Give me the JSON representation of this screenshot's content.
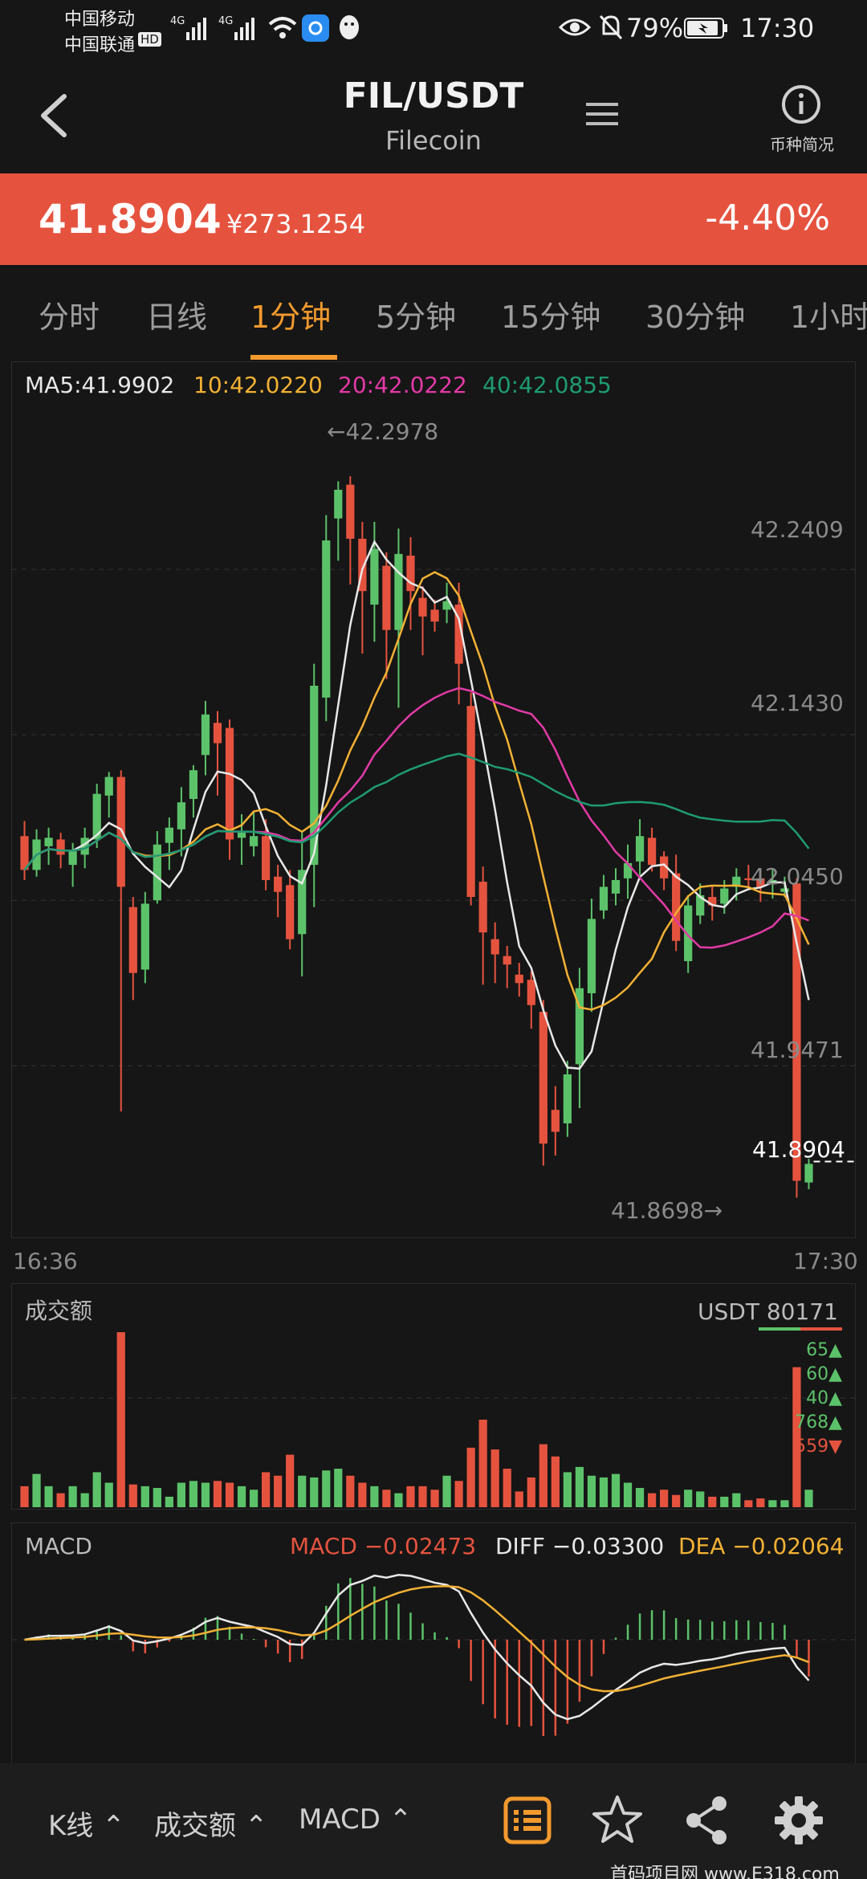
{
  "status": {
    "carrier1": "中国移动",
    "carrier2": "中国联通",
    "hd": "HD",
    "net1": "4G",
    "net2": "4G",
    "battery": "79%",
    "time": "17:30"
  },
  "header": {
    "title": "FIL/USDT",
    "subtitle": "Filecoin",
    "info_label": "币种简况"
  },
  "price": {
    "last": "41.8904",
    "cny": "¥273.1254",
    "change": "-4.40%",
    "bar_color": "#e5533f"
  },
  "tabs": [
    {
      "label": "分时",
      "active": false
    },
    {
      "label": "日线",
      "active": false
    },
    {
      "label": "1分钟",
      "active": true
    },
    {
      "label": "5分钟",
      "active": false
    },
    {
      "label": "15分钟",
      "active": false
    },
    {
      "label": "30分钟",
      "active": false
    },
    {
      "label": "1小时",
      "active": false
    }
  ],
  "kline": {
    "ma_legend": {
      "ma5": "MA5:41.9902",
      "ma10": "10:42.0220",
      "ma20": "20:42.0222",
      "ma40": "40:42.0855"
    },
    "colors": {
      "up": "#5cc26a",
      "down": "#e5533f",
      "ma5": "#e8e8e8",
      "ma10": "#f2b134",
      "ma20": "#e23aa6",
      "ma40": "#1e9b72"
    },
    "y_ticks": [
      "42.2409",
      "42.1430",
      "42.0450",
      "41.9471"
    ],
    "high_label": "←42.2978",
    "low_label": "41.8698→",
    "last_price_label": "41.8904",
    "x_start": "16:36",
    "x_end": "17:30"
  },
  "chart_data": {
    "type": "candlestick",
    "title": "",
    "x_range": [
      "16:36",
      "17:30"
    ],
    "ylim": [
      41.855,
      42.335
    ],
    "gridlines": [
      42.2409,
      42.143,
      42.045,
      41.9471
    ],
    "candles": [
      [
        42.083,
        42.063,
        42.092,
        42.057
      ],
      [
        42.063,
        42.081,
        42.087,
        42.059
      ],
      [
        42.077,
        42.082,
        42.088,
        42.066
      ],
      [
        42.081,
        42.072,
        42.085,
        42.064
      ],
      [
        42.066,
        42.074,
        42.079,
        42.053
      ],
      [
        42.072,
        42.082,
        42.088,
        42.064
      ],
      [
        42.081,
        42.108,
        42.114,
        42.076
      ],
      [
        42.107,
        42.118,
        42.121,
        42.094
      ],
      [
        42.118,
        42.053,
        42.122,
        41.92
      ],
      [
        42.041,
        42.002,
        42.047,
        41.986
      ],
      [
        42.004,
        42.043,
        42.05,
        41.996
      ],
      [
        42.045,
        42.078,
        42.086,
        42.043
      ],
      [
        42.079,
        42.088,
        42.094,
        42.063
      ],
      [
        42.087,
        42.103,
        42.112,
        42.071
      ],
      [
        42.105,
        42.122,
        42.125,
        42.094
      ],
      [
        42.131,
        42.155,
        42.163,
        42.119
      ],
      [
        42.15,
        42.138,
        42.157,
        42.107
      ],
      [
        42.147,
        42.081,
        42.152,
        42.069
      ],
      [
        42.082,
        42.085,
        42.096,
        42.066
      ],
      [
        42.077,
        42.083,
        42.097,
        42.071
      ],
      [
        42.083,
        42.057,
        42.093,
        42.051
      ],
      [
        42.059,
        42.05,
        42.066,
        42.035
      ],
      [
        42.054,
        42.022,
        42.063,
        42.016
      ],
      [
        42.025,
        42.063,
        42.085,
        42.0
      ],
      [
        42.066,
        42.172,
        42.185,
        42.041
      ],
      [
        42.165,
        42.258,
        42.273,
        42.151
      ],
      [
        42.271,
        42.288,
        42.293,
        42.246
      ],
      [
        42.291,
        42.259,
        42.296,
        42.232
      ],
      [
        42.259,
        42.228,
        42.269,
        42.191
      ],
      [
        42.22,
        42.253,
        42.269,
        42.198
      ],
      [
        42.243,
        42.205,
        42.251,
        42.176
      ],
      [
        42.205,
        42.25,
        42.265,
        42.159
      ],
      [
        42.249,
        42.228,
        42.26,
        42.205
      ],
      [
        42.224,
        42.213,
        42.231,
        42.19
      ],
      [
        42.217,
        42.21,
        42.223,
        42.204
      ],
      [
        42.217,
        42.222,
        42.233,
        42.209
      ],
      [
        42.22,
        42.185,
        42.233,
        42.161
      ],
      [
        42.16,
        42.047,
        42.168,
        42.042
      ],
      [
        42.056,
        42.026,
        42.065,
        41.995
      ],
      [
        42.022,
        42.013,
        42.032,
        41.996
      ],
      [
        42.012,
        42.007,
        42.018,
        41.993
      ],
      [
        42.001,
        41.996,
        42.008,
        41.988
      ],
      [
        41.998,
        41.983,
        42.003,
        41.969
      ],
      [
        41.979,
        41.901,
        41.986,
        41.888
      ],
      [
        41.921,
        41.908,
        41.935,
        41.894
      ],
      [
        41.913,
        41.942,
        41.95,
        41.905
      ],
      [
        41.948,
        41.993,
        42.005,
        41.922
      ],
      [
        41.99,
        42.034,
        42.046,
        41.979
      ],
      [
        42.039,
        42.053,
        42.06,
        42.034
      ],
      [
        42.049,
        42.057,
        42.064,
        42.042
      ],
      [
        42.058,
        42.067,
        42.078,
        42.046
      ],
      [
        42.068,
        42.083,
        42.093,
        42.06
      ],
      [
        42.082,
        42.066,
        42.088,
        42.062
      ],
      [
        42.071,
        42.058,
        42.074,
        42.051
      ],
      [
        42.061,
        42.021,
        42.072,
        42.015
      ],
      [
        42.009,
        42.042,
        42.048,
        42.002
      ],
      [
        42.036,
        42.048,
        42.055,
        42.031
      ],
      [
        42.047,
        42.042,
        42.054,
        42.033
      ],
      [
        42.043,
        42.052,
        42.057,
        42.037
      ],
      [
        42.053,
        42.059,
        42.064,
        42.045
      ],
      [
        42.058,
        42.057,
        42.066,
        42.051
      ],
      [
        42.058,
        42.053,
        42.064,
        42.044
      ],
      [
        42.055,
        42.057,
        42.063,
        42.046
      ],
      [
        42.05,
        42.052,
        42.059,
        42.047
      ],
      [
        42.055,
        41.879,
        42.058,
        41.869
      ],
      [
        41.878,
        41.889,
        41.892,
        41.874
      ]
    ],
    "high": 42.2978,
    "low": 41.8698,
    "last": 41.8904
  },
  "volume": {
    "label": "成交额",
    "unit_label": "USDT 80171",
    "levels": [
      {
        "value": "65▲",
        "dir": "up"
      },
      {
        "value": "60▲",
        "dir": "up"
      },
      {
        "value": "40▲",
        "dir": "up"
      },
      {
        "value": "768▲",
        "dir": "up"
      },
      {
        "value": "559▼",
        "dir": "down"
      }
    ],
    "values": [
      12,
      19,
      12,
      8,
      12,
      8,
      20,
      14,
      100,
      13,
      12,
      11,
      6,
      14,
      15,
      14,
      15,
      14,
      12,
      10,
      20,
      18,
      30,
      18,
      17,
      21,
      22,
      18,
      14,
      12,
      10,
      8,
      12,
      12,
      10,
      18,
      15,
      34,
      50,
      33,
      22,
      9,
      17,
      36,
      29,
      20,
      23,
      18,
      17,
      19,
      14,
      11,
      8,
      10,
      7,
      10,
      9,
      6,
      6,
      8,
      4,
      5,
      4,
      4,
      80,
      10
    ]
  },
  "macd": {
    "label": "MACD",
    "macd": "MACD −0.02473",
    "diff": "DIFF −0.03300",
    "dea": "DEA −0.02064",
    "colors": {
      "macd": "#e5533f",
      "diff": "#e8e8e8",
      "dea": "#f2b134"
    }
  },
  "toolbar": {
    "k_label": "K线",
    "vol_label": "成交额",
    "macd_label": "MACD",
    "accent": "#f29a2e"
  },
  "watermark": "首码项目网 www.E318.com"
}
